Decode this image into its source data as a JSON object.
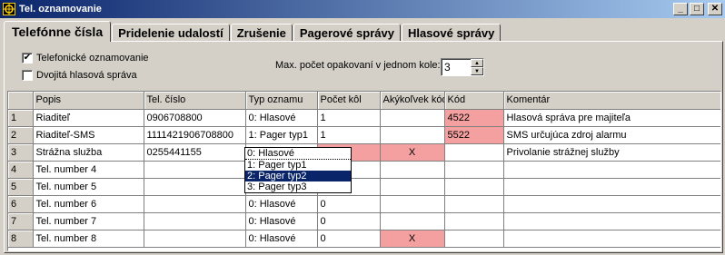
{
  "window": {
    "title": "Tel. oznamovanie"
  },
  "tabs": [
    {
      "label": "Telefónne čísla",
      "active": true
    },
    {
      "label": "Pridelenie udalostí"
    },
    {
      "label": "Zrušenie"
    },
    {
      "label": "Pagerové správy"
    },
    {
      "label": "Hlasové správy"
    }
  ],
  "options": {
    "tel_notify": {
      "label": "Telefonické oznamovanie",
      "checked": true
    },
    "double_voice": {
      "label": "Dvojitá hlasová správa",
      "checked": false
    },
    "max_repeats": {
      "label": "Max. počet opakovaní v jednom kole:",
      "value": "3"
    }
  },
  "table": {
    "columns": [
      "",
      "Popis",
      "Tel. číslo",
      "Typ oznamu",
      "Počet kôl",
      "Akýkoľvek kód",
      "Kód",
      "Komentár"
    ],
    "rows": [
      {
        "num": "1",
        "popis": "Riaditeľ",
        "tel": "0906708800",
        "typ": "0: Hlasové",
        "pocet": "1",
        "akykolvek": "",
        "kod": "4522",
        "komentar": "Hlasová správa pre majiteľa"
      },
      {
        "num": "2",
        "popis": "Riaditeľ-SMS",
        "tel": "1111421906708800",
        "typ": "1: Pager typ1",
        "pocet": "1",
        "akykolvek": "",
        "kod": "5522",
        "komentar": "SMS určujúca zdroj alarmu"
      },
      {
        "num": "3",
        "popis": "Strážna služba",
        "tel": "0255441155",
        "typ": "0: Hlasové",
        "pocet": "",
        "akykolvek": "X",
        "kod": "",
        "komentar": "Privolanie strážnej služby"
      },
      {
        "num": "4",
        "popis": "Tel. number 4",
        "tel": "",
        "typ": "",
        "pocet": "",
        "akykolvek": "",
        "kod": "",
        "komentar": ""
      },
      {
        "num": "5",
        "popis": "Tel. number 5",
        "tel": "",
        "typ": "",
        "pocet": "",
        "akykolvek": "",
        "kod": "",
        "komentar": ""
      },
      {
        "num": "6",
        "popis": "Tel. number 6",
        "tel": "",
        "typ": "0: Hlasové",
        "pocet": "0",
        "akykolvek": "",
        "kod": "",
        "komentar": ""
      },
      {
        "num": "7",
        "popis": "Tel. number 7",
        "tel": "",
        "typ": "0: Hlasové",
        "pocet": "0",
        "akykolvek": "",
        "kod": "",
        "komentar": ""
      },
      {
        "num": "8",
        "popis": "Tel. number 8",
        "tel": "",
        "typ": "0: Hlasové",
        "pocet": "0",
        "akykolvek": "X",
        "kod": "",
        "komentar": ""
      }
    ]
  },
  "dropdown": {
    "items": [
      "0: Hlasové",
      "1: Pager typ1",
      "2: Pager typ2",
      "3: Pager typ3"
    ],
    "selected_index": 2
  },
  "colors": {
    "highlight_cell": "#f4a0a0",
    "selection": "#0a246a"
  }
}
